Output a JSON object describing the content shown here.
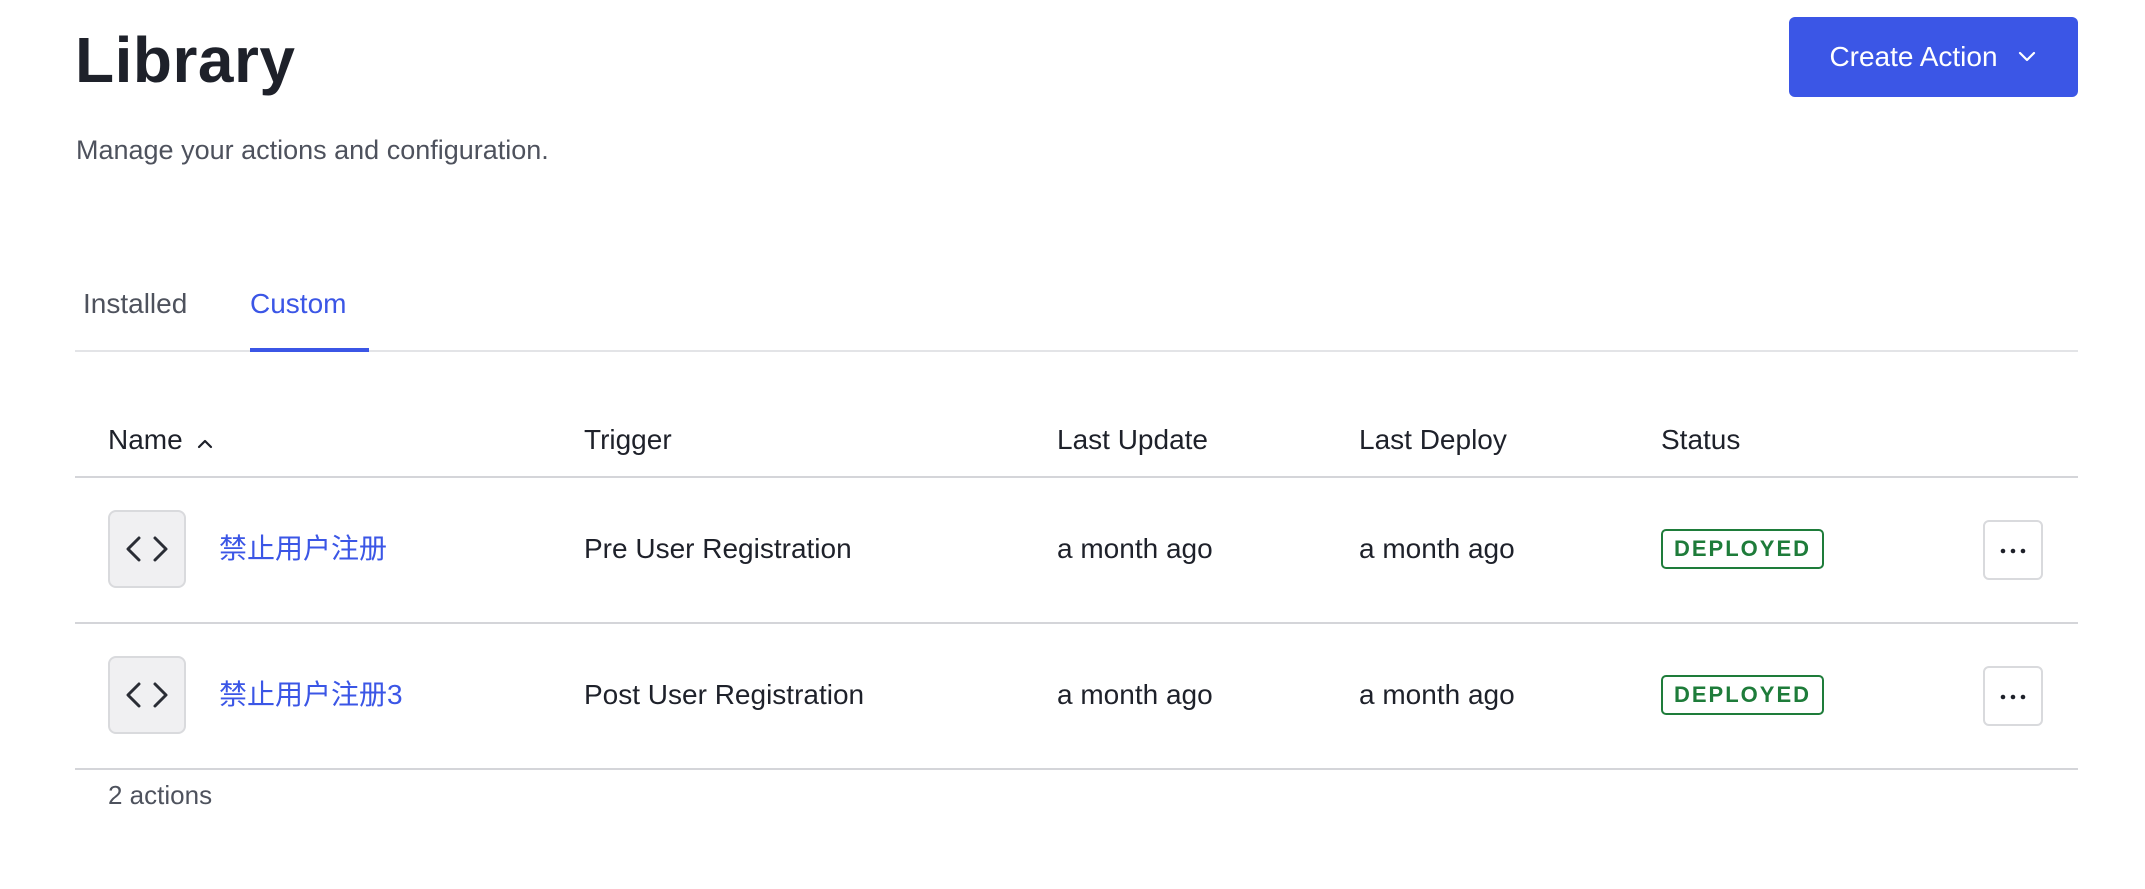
{
  "header": {
    "title": "Library",
    "subtitle": "Manage your actions and configuration.",
    "create_button_label": "Create Action"
  },
  "tabs": [
    {
      "label": "Installed",
      "active": false
    },
    {
      "label": "Custom",
      "active": true
    }
  ],
  "table": {
    "columns": {
      "name": "Name",
      "trigger": "Trigger",
      "last_update": "Last Update",
      "last_deploy": "Last Deploy",
      "status": "Status"
    },
    "sort": {
      "column": "Name",
      "direction": "ascending"
    },
    "rows": [
      {
        "name": "禁止用户注册",
        "trigger": "Pre User Registration",
        "last_update": "a month ago",
        "last_deploy": "a month ago",
        "status": "DEPLOYED"
      },
      {
        "name": "禁止用户注册3",
        "trigger": "Post User Registration",
        "last_update": "a month ago",
        "last_deploy": "a month ago",
        "status": "DEPLOYED"
      }
    ]
  },
  "footer": {
    "count_text": "2 actions"
  },
  "colors": {
    "accent": "#3b56e6",
    "status_deployed": "#1e7c3a",
    "text_primary": "#1e212a",
    "text_secondary": "#4e525d"
  },
  "icons": {
    "row_icon": "code-icon",
    "sort_icon": "chevron-up-icon",
    "button_icon": "chevron-down-icon",
    "row_menu_icon": "more-horizontal-icon"
  }
}
